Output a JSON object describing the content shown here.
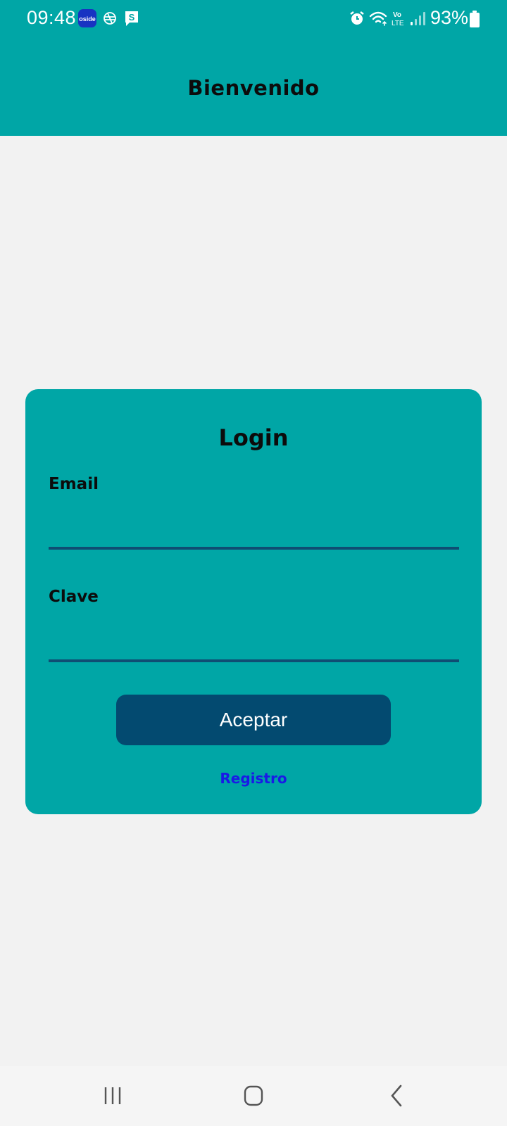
{
  "status_bar": {
    "time": "09:48",
    "app_icons": [
      "oside-icon",
      "globe-icon",
      "s-chat-icon"
    ],
    "system_icons": [
      "alarm-icon",
      "wifi-icon",
      "volte-icon",
      "signal-icon"
    ],
    "volte_label": "Vo\nLTE",
    "badge_text": "oside",
    "s_icon_text": "S",
    "battery": "93%"
  },
  "header": {
    "title": "Bienvenido",
    "background": "#00a6a6"
  },
  "login": {
    "title": "Login",
    "email_label": "Email",
    "email_value": "",
    "password_label": "Clave",
    "password_value": "",
    "accept_label": "Aceptar",
    "register_label": "Registro",
    "card_color": "#00a6a6",
    "button_color": "#034a70",
    "link_color": "#1a1ae6"
  },
  "nav_bar": {
    "buttons": [
      "recents-icon",
      "home-icon",
      "back-icon"
    ]
  }
}
